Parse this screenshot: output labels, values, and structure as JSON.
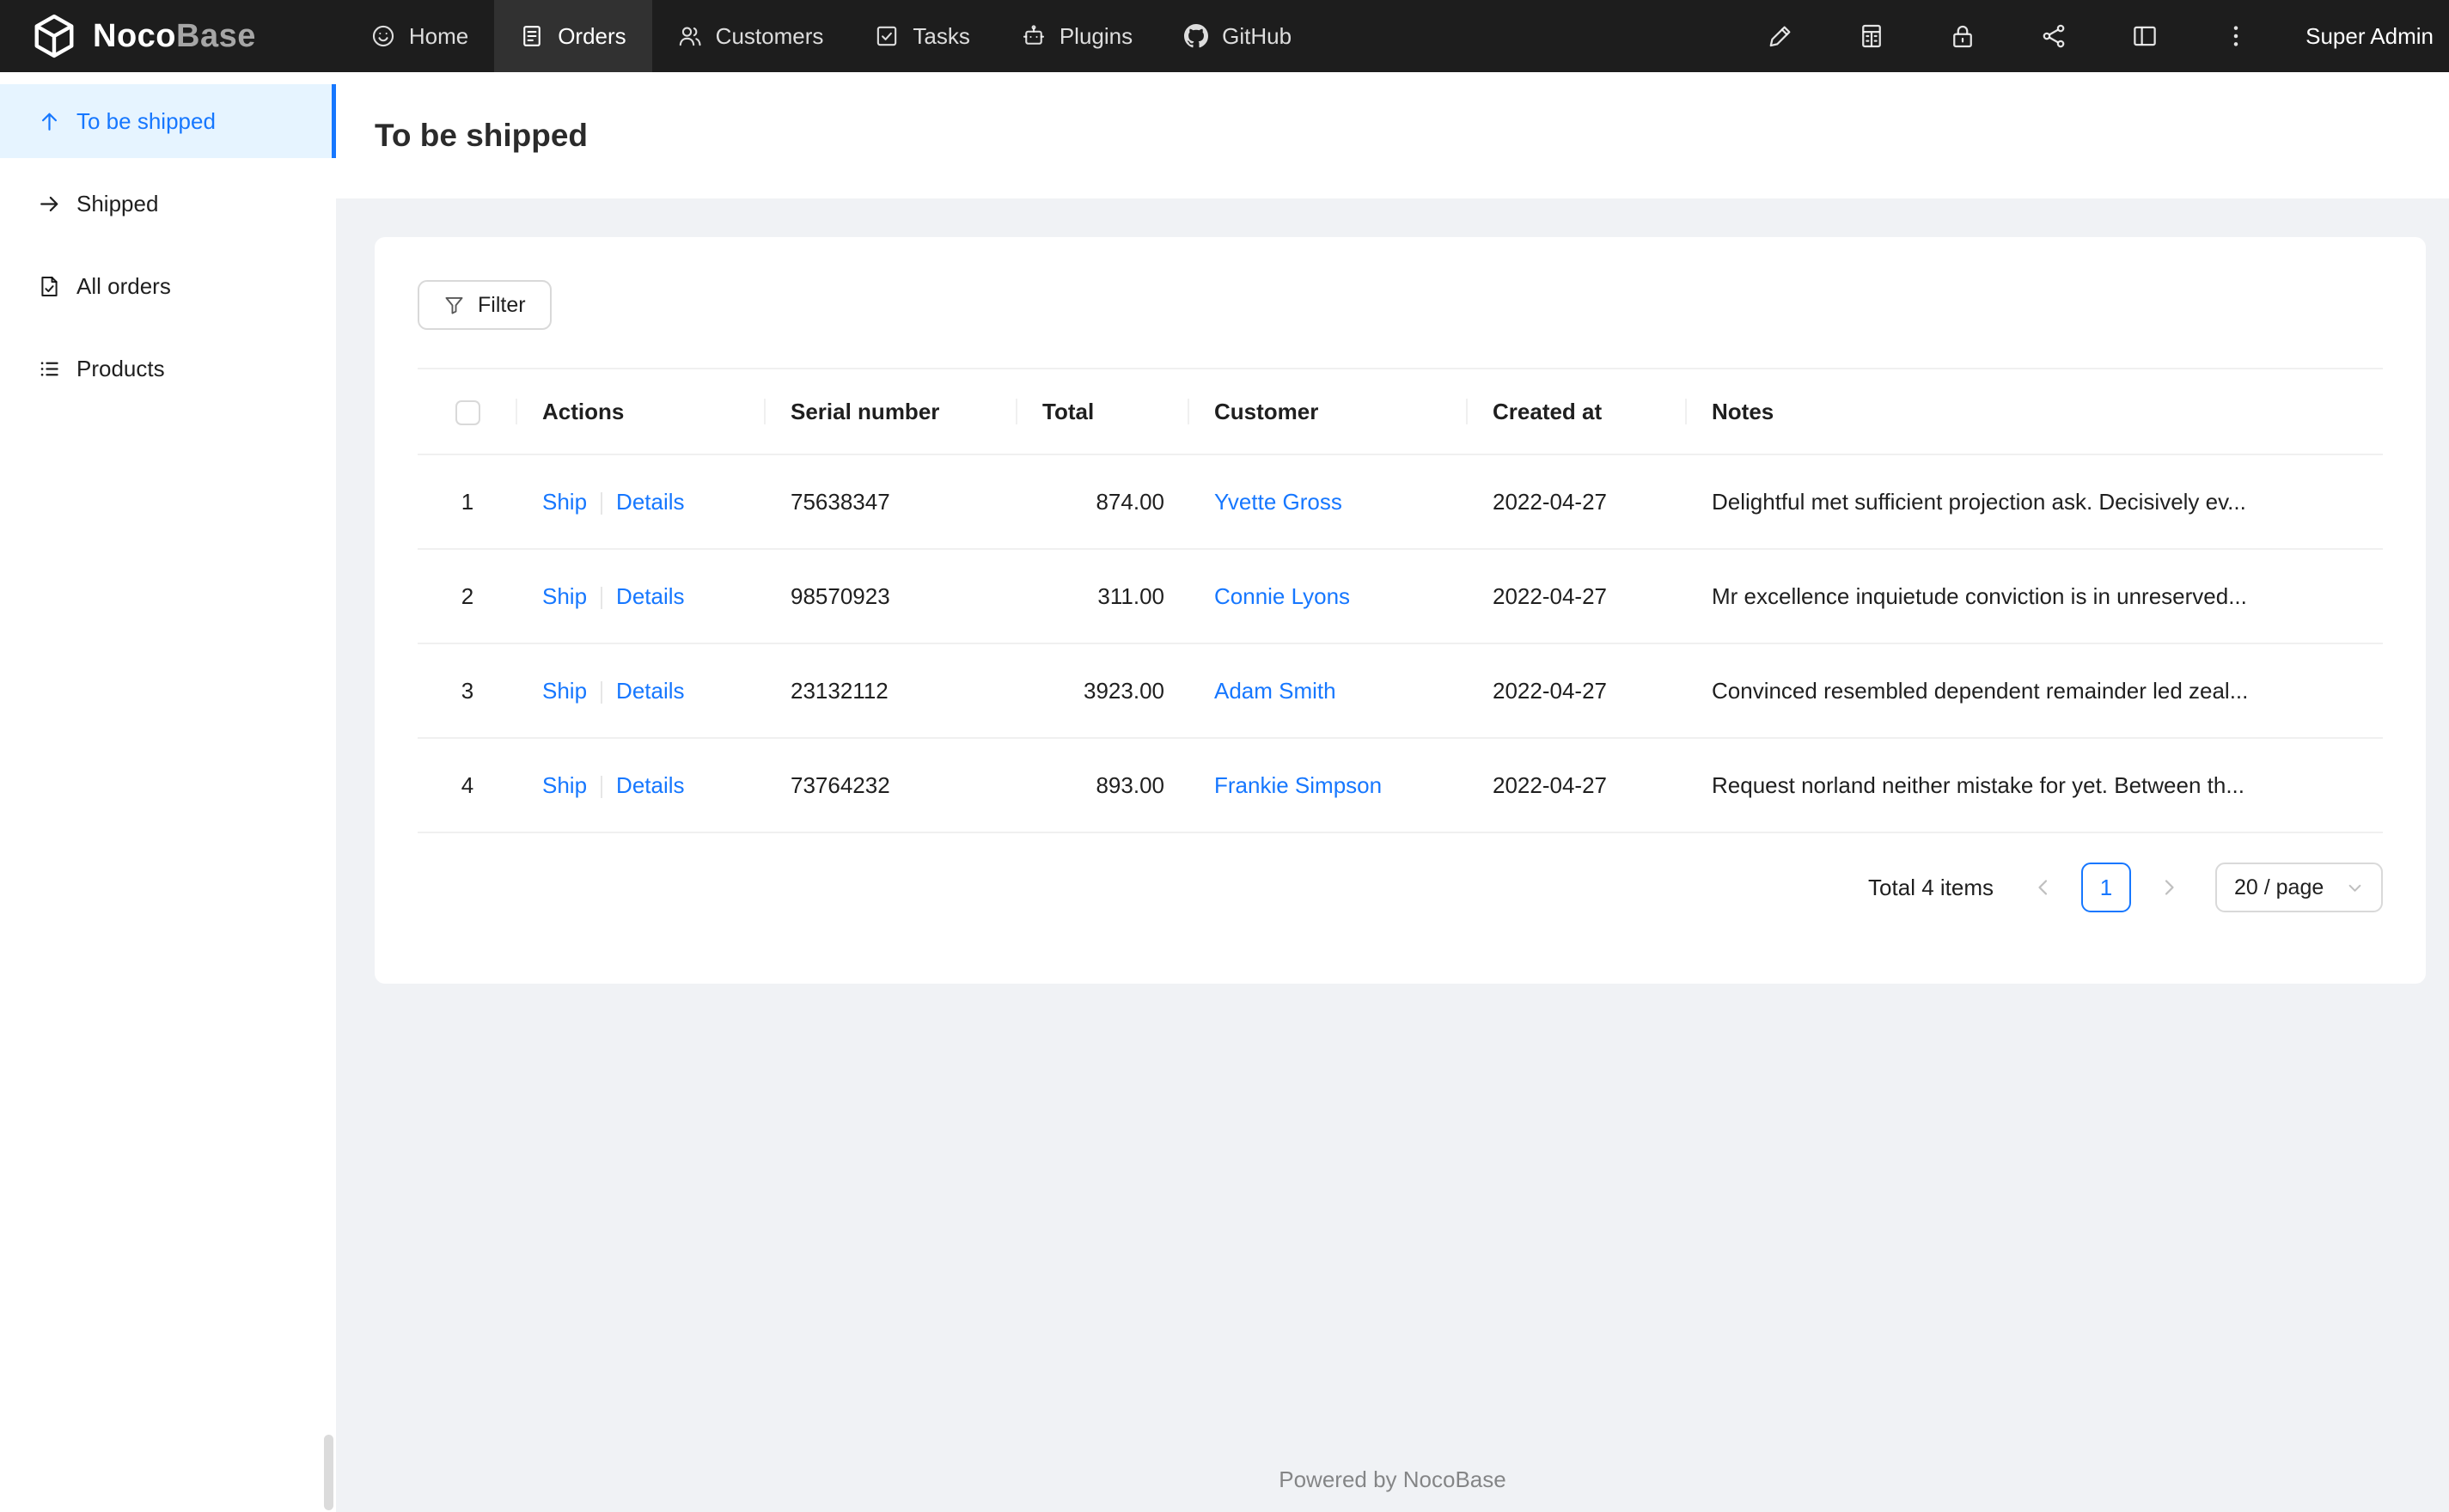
{
  "colors": {
    "accent": "#1677ff",
    "navbar_bg": "#1d1d1d",
    "navbar_active_bg": "#313131",
    "sidebar_active_bg": "#e6f4ff",
    "layout_bg": "#f0f2f5",
    "border": "#f0f0f0"
  },
  "icons": {
    "logo": "cube-wireframe-icon",
    "nav": [
      "smile-icon",
      "orders-doc-icon",
      "customers-icon",
      "tasks-check-square-icon",
      "plugins-robot-icon",
      "github-icon"
    ],
    "navbar_right": [
      "highlight-pen-icon",
      "table-icon",
      "lock-icon",
      "share-nodes-icon",
      "layout-columns-icon",
      "more-vertical-icon"
    ],
    "sidebar": [
      "arrow-up-icon",
      "arrow-right-icon",
      "file-check-icon",
      "unordered-list-icon"
    ],
    "filter": "funnel-icon",
    "pagination": [
      "chevron-left-icon",
      "chevron-right-icon",
      "chevron-down-icon"
    ]
  },
  "navbar": {
    "logo_noco": "Noco",
    "logo_base": "Base",
    "items": [
      {
        "label": "Home"
      },
      {
        "label": "Orders"
      },
      {
        "label": "Customers"
      },
      {
        "label": "Tasks"
      },
      {
        "label": "Plugins"
      },
      {
        "label": "GitHub"
      }
    ],
    "user": "Super Admin"
  },
  "sidebar": {
    "items": [
      {
        "label": "To be shipped"
      },
      {
        "label": "Shipped"
      },
      {
        "label": "All orders"
      },
      {
        "label": "Products"
      }
    ]
  },
  "page": {
    "title": "To be shipped"
  },
  "toolbar": {
    "filter_label": "Filter"
  },
  "table": {
    "headers": {
      "actions": "Actions",
      "serial": "Serial number",
      "total": "Total",
      "customer": "Customer",
      "created": "Created at",
      "notes": "Notes"
    },
    "rows": [
      {
        "index": "1",
        "ship": "Ship",
        "details": "Details",
        "serial": "75638347",
        "total": "874.00",
        "customer": "Yvette Gross",
        "created": "2022-04-27",
        "notes": "Delightful met sufficient projection ask. Decisively ev..."
      },
      {
        "index": "2",
        "ship": "Ship",
        "details": "Details",
        "serial": "98570923",
        "total": "311.00",
        "customer": "Connie Lyons",
        "created": "2022-04-27",
        "notes": "Mr excellence inquietude conviction is in unreserved..."
      },
      {
        "index": "3",
        "ship": "Ship",
        "details": "Details",
        "serial": "23132112",
        "total": "3923.00",
        "customer": "Adam Smith",
        "created": "2022-04-27",
        "notes": "Convinced resembled dependent remainder led zeal..."
      },
      {
        "index": "4",
        "ship": "Ship",
        "details": "Details",
        "serial": "73764232",
        "total": "893.00",
        "customer": "Frankie Simpson",
        "created": "2022-04-27",
        "notes": "Request norland neither mistake for yet. Between th..."
      }
    ]
  },
  "pagination": {
    "total_text": "Total 4 items",
    "current_page": "1",
    "page_size": "20 / page"
  },
  "footer": {
    "text": "Powered by NocoBase"
  }
}
